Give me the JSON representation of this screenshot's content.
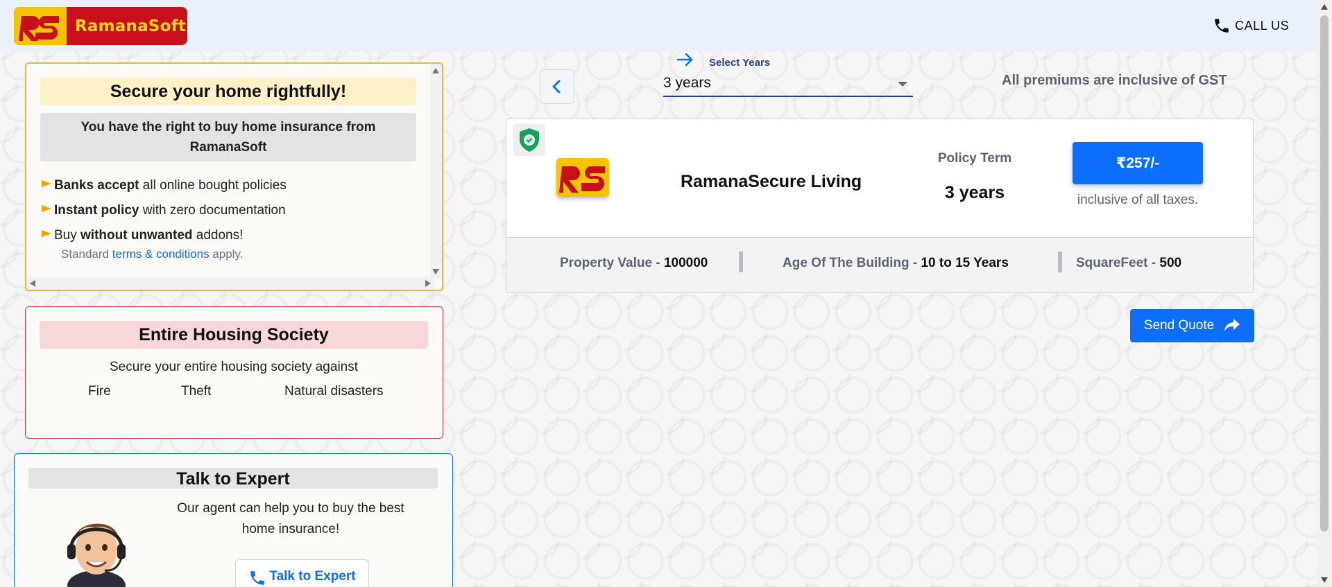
{
  "header": {
    "brand": "RamanaSoft",
    "call_label": "CALL US"
  },
  "promo": {
    "title": "Secure your home rightfully!",
    "subtitle": "You have the right to buy home insurance from RamanaSoft",
    "bullets": [
      {
        "strong": "Banks accept",
        "rest": " all online bought policies"
      },
      {
        "strong": "Instant policy",
        "rest": " with zero documentation"
      },
      {
        "pre": "Buy ",
        "strong": "without unwanted",
        "rest": " addons!"
      }
    ],
    "terms_pre": "Standard ",
    "terms_link": "terms & conditions",
    "terms_post": " apply."
  },
  "society": {
    "title": "Entire Housing Society",
    "description": "Secure your entire housing society against",
    "risks": [
      "Fire",
      "Theft",
      "Natural disasters"
    ]
  },
  "expert": {
    "title": "Talk to Expert",
    "description": "Our agent can help you to buy the best home insurance!",
    "button_label": "Talk to Expert"
  },
  "controls": {
    "years_label": "Select Years",
    "years_value": "3 years",
    "gst_note": "All premiums are inclusive of GST"
  },
  "policy": {
    "name": "RamanaSecure Living",
    "term_label": "Policy Term",
    "term_value": "3 years",
    "price": "₹257/-",
    "price_note": "inclusive of all taxes.",
    "facts": [
      {
        "label": "Property Value - ",
        "value": "100000"
      },
      {
        "label": "Age Of The Building - ",
        "value": "10 to 15 Years"
      },
      {
        "label": "SquareFeet - ",
        "value": "500"
      }
    ]
  },
  "send_quote_label": "Send Quote",
  "colors": {
    "primary": "#0d6efd",
    "brand_red": "#c8101a",
    "brand_yellow": "#f5c400",
    "warning_border": "#e5b94a",
    "danger_border": "#dc3545",
    "header_bg": "#eaf1fb"
  }
}
